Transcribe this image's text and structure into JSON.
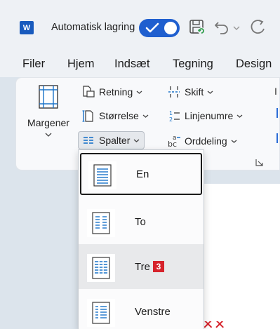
{
  "titlebar": {
    "app_logo_letter": "W",
    "autosave_label": "Automatisk lagring",
    "autosave_on": true
  },
  "tabs": [
    "Filer",
    "Hjem",
    "Indsæt",
    "Tegning",
    "Design"
  ],
  "ribbon": {
    "margins_label": "Margener",
    "orientation_label": "Retning",
    "size_label": "Størrelse",
    "columns_label": "Spalter",
    "breaks_label": "Skift",
    "line_numbers_label": "Linjenumre",
    "hyphenation_label": "Orddeling",
    "cut_letter": "I"
  },
  "columns_menu": {
    "items": [
      {
        "label": "En",
        "state": "selected"
      },
      {
        "label": "To",
        "state": "normal"
      },
      {
        "label": "Tre",
        "state": "hover",
        "badge": "3"
      },
      {
        "label": "Venstre",
        "state": "normal"
      }
    ]
  },
  "colors": {
    "accent": "#1f5fcf",
    "badge": "#d6232c",
    "word_blue": "#185abd"
  }
}
